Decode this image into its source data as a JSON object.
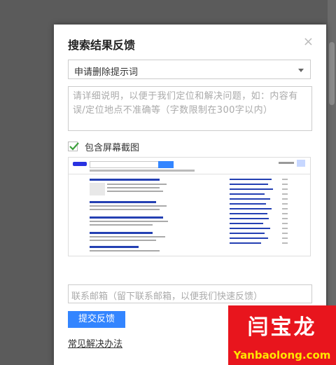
{
  "dialog": {
    "title": "搜索结果反馈",
    "close_glyph": "×",
    "select_value": "申请删除提示词",
    "description_placeholder": "请详细说明，以便于我们定位和解决问题，如：内容有误/定位地点不准确等（字数限制在300字以内）",
    "checkbox_label": "包含屏幕截图",
    "checkbox_checked": true,
    "email_placeholder": "联系邮箱（留下联系邮箱，以便我们快速反馈）",
    "submit_label": "提交反馈",
    "faq_link": "常见解决办法"
  },
  "watermark": {
    "cn": "闫宝龙",
    "en": "Yanbaolong.com"
  },
  "colors": {
    "overlay": "#5b5b5b",
    "submit_bg": "#3385ff",
    "checkmark": "#3c9f3c",
    "watermark_bg": "#e8151d",
    "watermark_en": "#ffe600"
  }
}
